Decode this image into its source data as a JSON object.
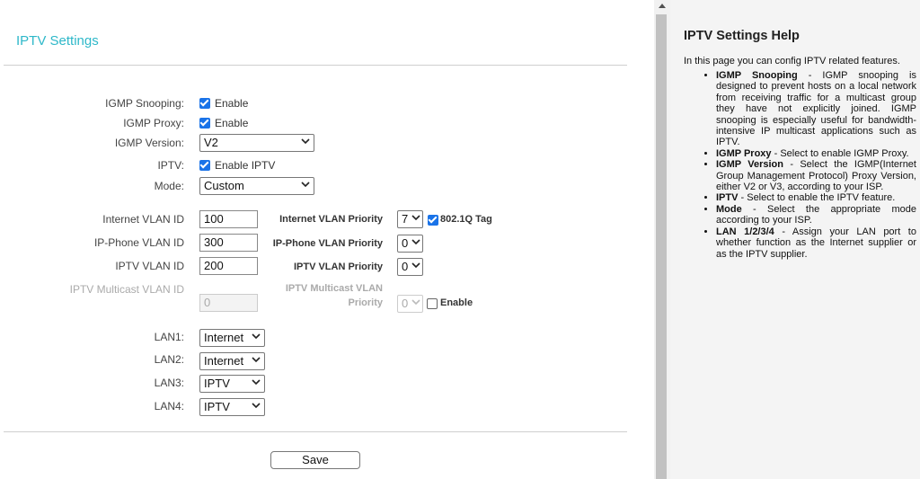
{
  "page": {
    "title": "IPTV Settings"
  },
  "igmp": {
    "snooping_label": "IGMP Snooping:",
    "snooping_text": "Enable",
    "proxy_label": "IGMP Proxy:",
    "proxy_text": "Enable",
    "version_label": "IGMP Version:",
    "version_value": "V2"
  },
  "iptv": {
    "label": "IPTV:",
    "text": "Enable IPTV"
  },
  "mode": {
    "label": "Mode:",
    "value": "Custom"
  },
  "vlan": {
    "internet_id_label": "Internet VLAN ID",
    "internet_id_value": "100",
    "internet_priority_label": "Internet VLAN Priority",
    "internet_priority_value": "7",
    "tag_text": "802.1Q Tag",
    "phone_id_label": "IP-Phone VLAN ID",
    "phone_id_value": "300",
    "phone_priority_label": "IP-Phone VLAN Priority",
    "phone_priority_value": "0",
    "iptv_id_label": "IPTV VLAN ID",
    "iptv_id_value": "200",
    "iptv_priority_label": "IPTV VLAN Priority",
    "iptv_priority_value": "0",
    "multicast_id_label": "IPTV Multicast VLAN ID",
    "multicast_priority_label_1": "IPTV Multicast VLAN",
    "multicast_priority_label_2": "Priority",
    "multicast_id_value": "0",
    "multicast_priority_value": "0",
    "multicast_enable_text": "Enable"
  },
  "lan": {
    "lan1_label": "LAN1:",
    "lan1_value": "Internet",
    "lan2_label": "LAN2:",
    "lan2_value": "Internet",
    "lan3_label": "LAN3:",
    "lan3_value": "IPTV",
    "lan4_label": "LAN4:",
    "lan4_value": "IPTV"
  },
  "actions": {
    "save_label": "Save"
  },
  "help": {
    "title": "IPTV Settings Help",
    "intro": "In this page you can config IPTV related features.",
    "items": [
      {
        "term": "IGMP Snooping",
        "desc": " - IGMP snooping is designed to prevent hosts on a local network from receiving traffic for a multicast group they have not explicitly joined. IGMP snooping is especially useful for bandwidth-intensive IP multicast applications such as IPTV."
      },
      {
        "term": "IGMP Proxy",
        "desc": " - Select to enable IGMP Proxy."
      },
      {
        "term": "IGMP Version",
        "desc": " - Select the IGMP(Internet Group Management Protocol) Proxy Version, either V2 or V3, according to your ISP."
      },
      {
        "term": "IPTV",
        "desc": " - Select to enable the IPTV feature."
      },
      {
        "term": "Mode",
        "desc": " - Select the appropriate mode according to your ISP."
      },
      {
        "term": "LAN 1/2/3/4",
        "desc": " - Assign your LAN port to whether function as the Internet supplier or as the IPTV supplier."
      }
    ]
  },
  "colors": {
    "accent": "#2eb8c9",
    "checkbox": "#1a73e8",
    "help_bg": "#f4f4f4"
  }
}
